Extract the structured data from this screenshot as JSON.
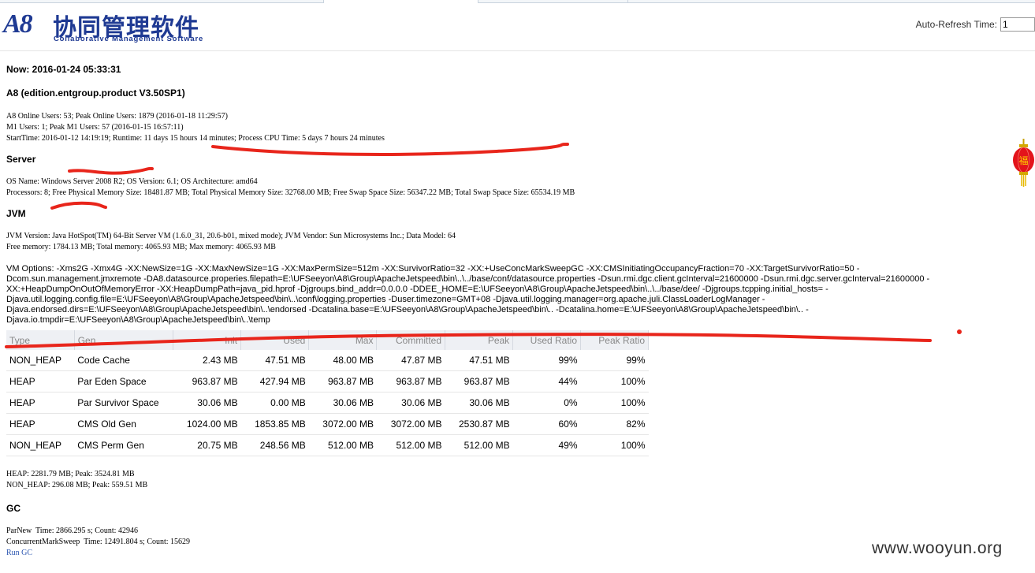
{
  "header": {
    "logo_mark": "A8",
    "logo_cn": "协同管理软件",
    "logo_en": "Collaborative Management Software",
    "refresh_label": "Auto-Refresh Time:",
    "refresh_value": "1"
  },
  "now": "Now: 2016-01-24 05:33:31",
  "edition": "A8 (edition.entgroup.product V3.50SP1)",
  "users": {
    "online": "A8 Online Users: 53; Peak Online Users: 1879 (2016-01-18 11:29:57)",
    "m1": "M1 Users: 1; Peak M1 Users: 57 (2016-01-15 16:57:11)",
    "start": "StartTime: 2016-01-12 14:19:19; Runtime: 11 days 15 hours 14 minutes; Process CPU Time: 5 days 7 hours 24 minutes"
  },
  "server": {
    "title": "Server",
    "os": "OS Name: Windows Server 2008 R2; OS Version: 6.1; OS Architecture: amd64",
    "proc": "Processors: 8; Free Physical Memory Size: 18481.87 MB; Total Physical Memory Size: 32768.00 MB; Free Swap Space Size: 56347.22 MB; Total Swap Space Size: 65534.19 MB"
  },
  "jvm": {
    "title": "JVM",
    "version": "JVM Version: Java HotSpot(TM) 64-Bit Server VM (1.6.0_31, 20.6-b01, mixed mode); JVM Vendor: Sun Microsystems Inc.; Data Model: 64",
    "memory": "Free memory: 1784.13 MB; Total memory: 4065.93 MB; Max memory: 4065.93 MB",
    "options": [
      "VM Options: -Xms2G -Xmx4G -XX:NewSize=1G -XX:MaxNewSize=1G -XX:MaxPermSize=512m -XX:SurvivorRatio=32 -XX:+UseConcMarkSweepGC -XX:CMSInitiatingOccupancyFraction=70 -XX:TargetSurvivorRatio=50 -",
      "Dcom.sun.management.jmxremote -DA8.datasource.properies.filepath=E:\\UFSeeyon\\A8\\Group\\ApacheJetspeed\\bin\\..\\../base/conf/datasource.properties -Dsun.rmi.dgc.client.gcInterval=21600000 -Dsun.rmi.dgc.server.gcInterval=21600000 -",
      "XX:+HeapDumpOnOutOfMemoryError -XX:HeapDumpPath=java_pid.hprof -Djgroups.bind_addr=0.0.0.0 -DDEE_HOME=E:\\UFSeeyon\\A8\\Group\\ApacheJetspeed\\bin\\..\\../base/dee/ -Djgroups.tcpping.initial_hosts= -",
      "Djava.util.logging.config.file=E:\\UFSeeyon\\A8\\Group\\ApacheJetspeed\\bin\\..\\conf\\logging.properties -Duser.timezone=GMT+08 -Djava.util.logging.manager=org.apache.juli.ClassLoaderLogManager -",
      "Djava.endorsed.dirs=E:\\UFSeeyon\\A8\\Group\\ApacheJetspeed\\bin\\..\\endorsed -Dcatalina.base=E:\\UFSeeyon\\A8\\Group\\ApacheJetspeed\\bin\\.. -Dcatalina.home=E:\\UFSeeyon\\A8\\Group\\ApacheJetspeed\\bin\\.. -",
      "Djava.io.tmpdir=E:\\UFSeeyon\\A8\\Group\\ApacheJetspeed\\bin\\..\\temp"
    ]
  },
  "table": {
    "headers": [
      "Type",
      "Gen",
      "Init",
      "Used",
      "Max",
      "Committed",
      "Peak",
      "Used Ratio",
      "Peak Ratio"
    ],
    "rows": [
      [
        "NON_HEAP",
        "Code Cache",
        "2.43 MB",
        "47.51 MB",
        "48.00 MB",
        "47.87 MB",
        "47.51 MB",
        "99%",
        "99%"
      ],
      [
        "HEAP",
        "Par Eden Space",
        "963.87 MB",
        "427.94 MB",
        "963.87 MB",
        "963.87 MB",
        "963.87 MB",
        "44%",
        "100%"
      ],
      [
        "HEAP",
        "Par Survivor Space",
        "30.06 MB",
        "0.00 MB",
        "30.06 MB",
        "30.06 MB",
        "30.06 MB",
        "0%",
        "100%"
      ],
      [
        "HEAP",
        "CMS Old Gen",
        "1024.00 MB",
        "1853.85 MB",
        "3072.00 MB",
        "3072.00 MB",
        "2530.87 MB",
        "60%",
        "82%"
      ],
      [
        "NON_HEAP",
        "CMS Perm Gen",
        "20.75 MB",
        "248.56 MB",
        "512.00 MB",
        "512.00 MB",
        "512.00 MB",
        "49%",
        "100%"
      ]
    ]
  },
  "summary": {
    "heap": "HEAP: 2281.79 MB; Peak: 3524.81 MB",
    "nonheap": "NON_HEAP: 296.08 MB; Peak: 559.51 MB"
  },
  "gc": {
    "title": "GC",
    "parnew": "ParNew  Time: 2866.295 s; Count: 42946",
    "cms": "ConcurrentMarkSweep  Time: 12491.804 s; Count: 15629",
    "run_link": "Run GC"
  },
  "watermark": "www.wooyun.org",
  "annotation_color": "#e8251b",
  "brand_color": "#1f3a93"
}
